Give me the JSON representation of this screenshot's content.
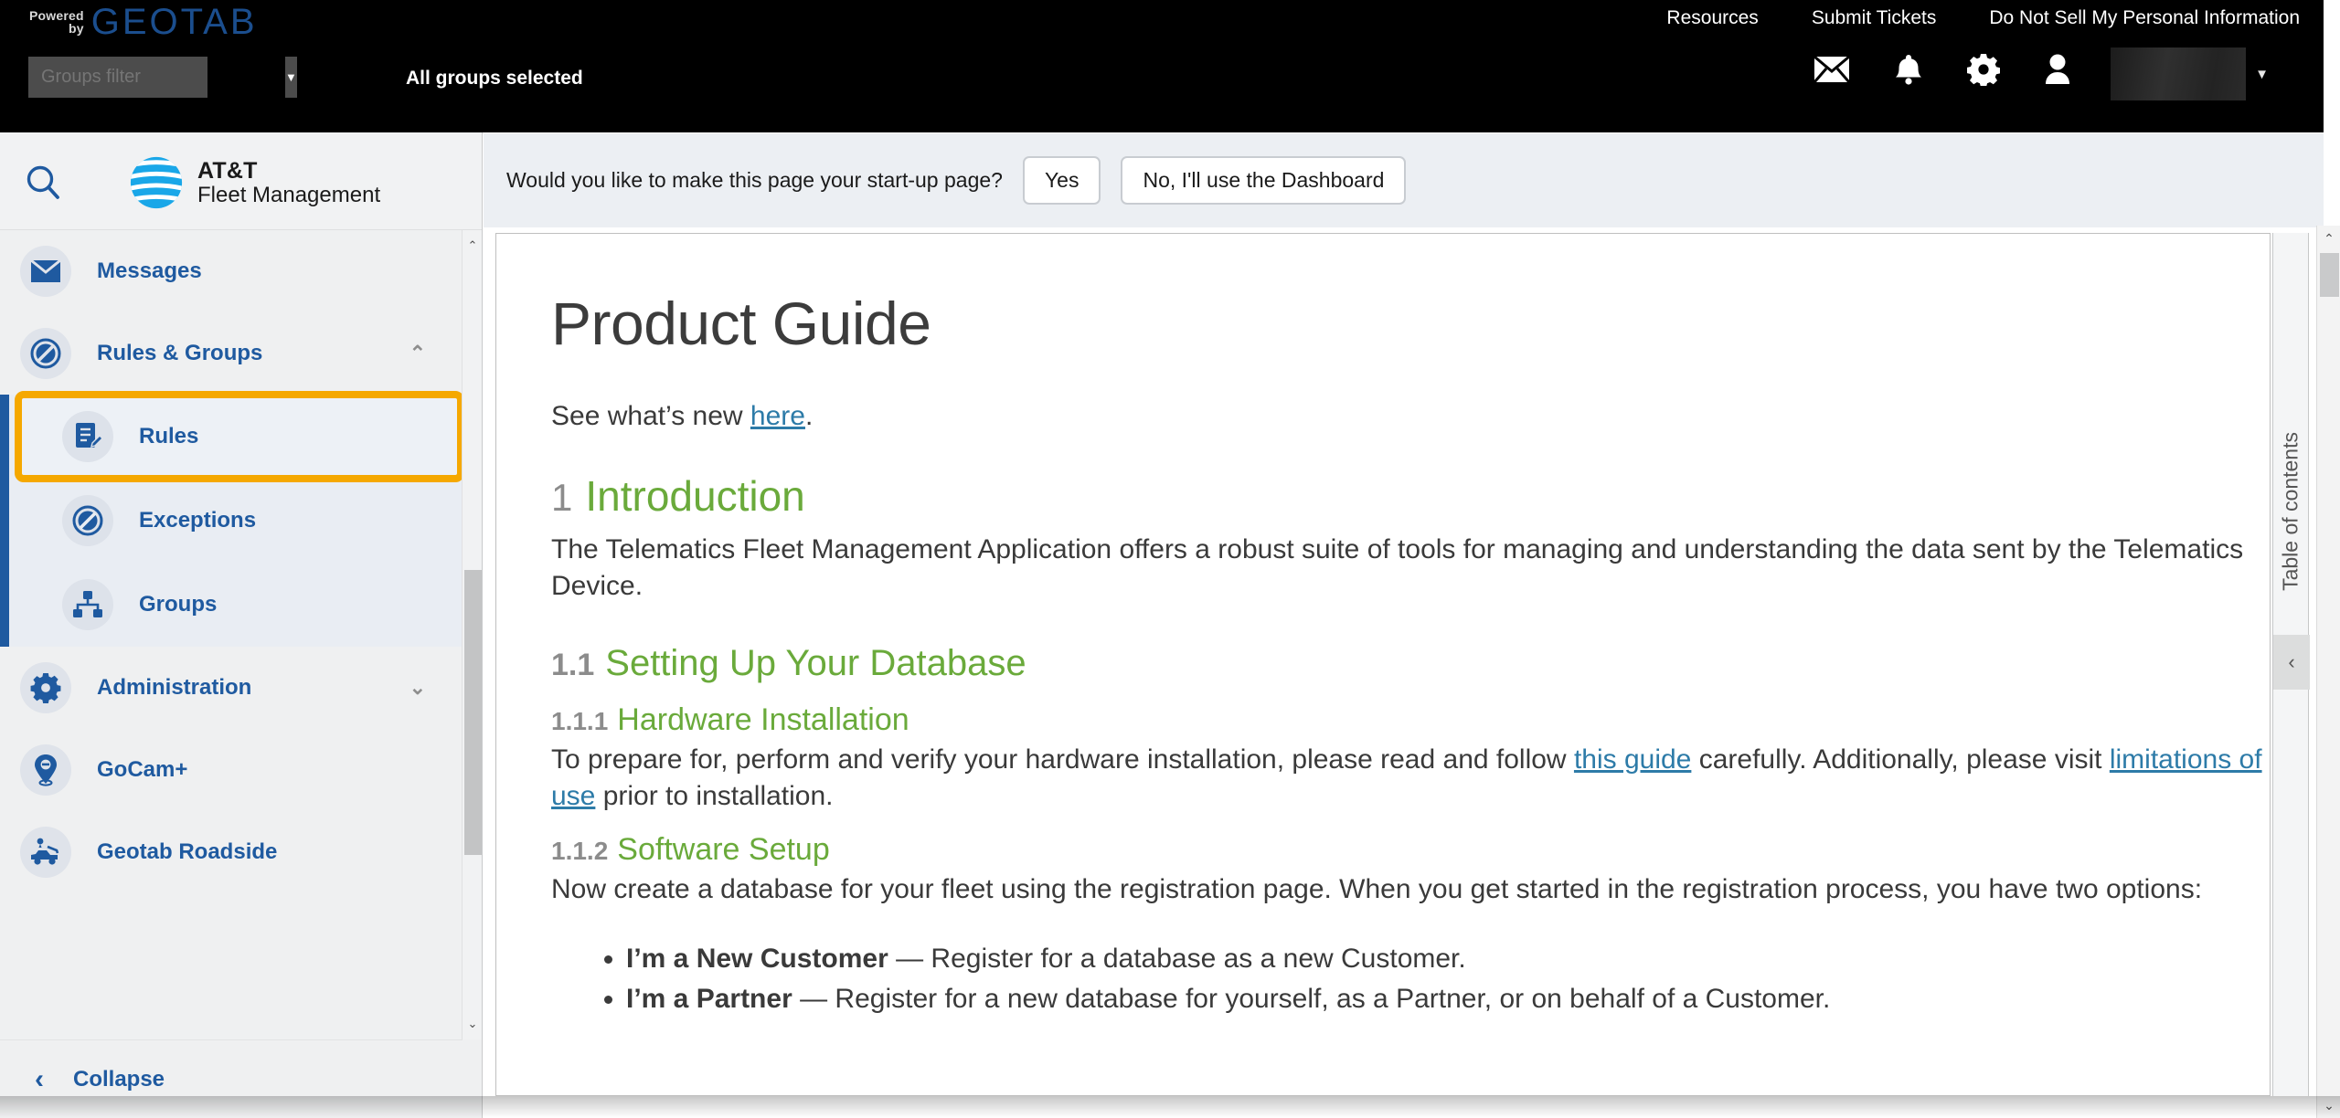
{
  "topbar": {
    "powered": "Powered",
    "by": "by",
    "brand": "GEOTAB",
    "groups_filter_placeholder": "Groups filter",
    "groups_filter_value": "",
    "all_groups_selected": "All groups selected",
    "links": [
      {
        "label": "Resources"
      },
      {
        "label": "Submit Tickets"
      },
      {
        "label": "Do Not Sell My Personal Information"
      }
    ],
    "icons": [
      {
        "name": "mail-icon"
      },
      {
        "name": "bell-icon"
      },
      {
        "name": "gear-icon"
      },
      {
        "name": "user-icon"
      }
    ],
    "user_name": "",
    "user_caret": "▼"
  },
  "sidebar": {
    "search_icon": "search-icon",
    "brand_line1": "AT&T",
    "brand_line2": "Fleet Management",
    "items": [
      {
        "label": "Messages",
        "icon": "mail-icon",
        "chevron": ""
      },
      {
        "label": "Rules & Groups",
        "icon": "no-entry-icon",
        "chevron": "⌃"
      },
      {
        "label": "Rules",
        "icon": "rules-document-icon",
        "chevron": ""
      },
      {
        "label": "Exceptions",
        "icon": "no-entry-icon",
        "chevron": ""
      },
      {
        "label": "Groups",
        "icon": "org-tree-icon",
        "chevron": ""
      },
      {
        "label": "Administration",
        "icon": "gear-icon",
        "chevron": "⌄"
      },
      {
        "label": "GoCam+",
        "icon": "camera-pin-icon",
        "chevron": ""
      },
      {
        "label": "Geotab Roadside",
        "icon": "tow-truck-icon",
        "chevron": ""
      }
    ],
    "collapse_label": "Collapse",
    "collapse_icon": "chevron-left-icon",
    "scroll_up": "⌃",
    "scroll_down": "⌄",
    "highlight_color": "#f5a800"
  },
  "banner": {
    "question": "Would you like to make this page your start-up page?",
    "yes_label": "Yes",
    "no_label": "No, I'll use the Dashboard"
  },
  "document": {
    "title": "Product Guide",
    "intro_prefix": "See what’s new ",
    "intro_link": "here",
    "intro_suffix": ".",
    "h1_num": "1",
    "h1_text": "Introduction",
    "intro_paragraph": "The Telematics Fleet Management Application offers a robust suite of tools for managing and understanding the data sent by the Telematics Device.",
    "h2_num": "1.1",
    "h2_text": "Setting Up Your Database",
    "h3a_num": "1.1.1",
    "h3a_text": "Hardware Installation",
    "hw_p_part1": "To prepare for, perform and verify your hardware installation, please read and follow ",
    "hw_p_link1": "this guide",
    "hw_p_part2": " carefully. Additionally, please visit ",
    "hw_p_link2": "limitations of use",
    "hw_p_part3": " prior to installation.",
    "h3b_num": "1.1.2",
    "h3b_text": "Software Setup",
    "sw_paragraph": "Now create a database for your fleet using the registration page. When you get started in the registration process, you have two options:",
    "bullets": [
      {
        "bold": "I’m a New Customer",
        "rest": " — Register for a database as a new Customer."
      },
      {
        "bold": "I’m a Partner",
        "rest": " — Register for a new database for yourself, as a Partner, or on behalf of a Customer."
      }
    ],
    "heading_color": "#6aaa3b",
    "link_color": "#2d7ba8"
  },
  "toc": {
    "label": "Table of contents",
    "collapse_icon": "chevron-left-icon"
  },
  "page_scroll": {
    "up": "⌃",
    "down": "⌄"
  }
}
